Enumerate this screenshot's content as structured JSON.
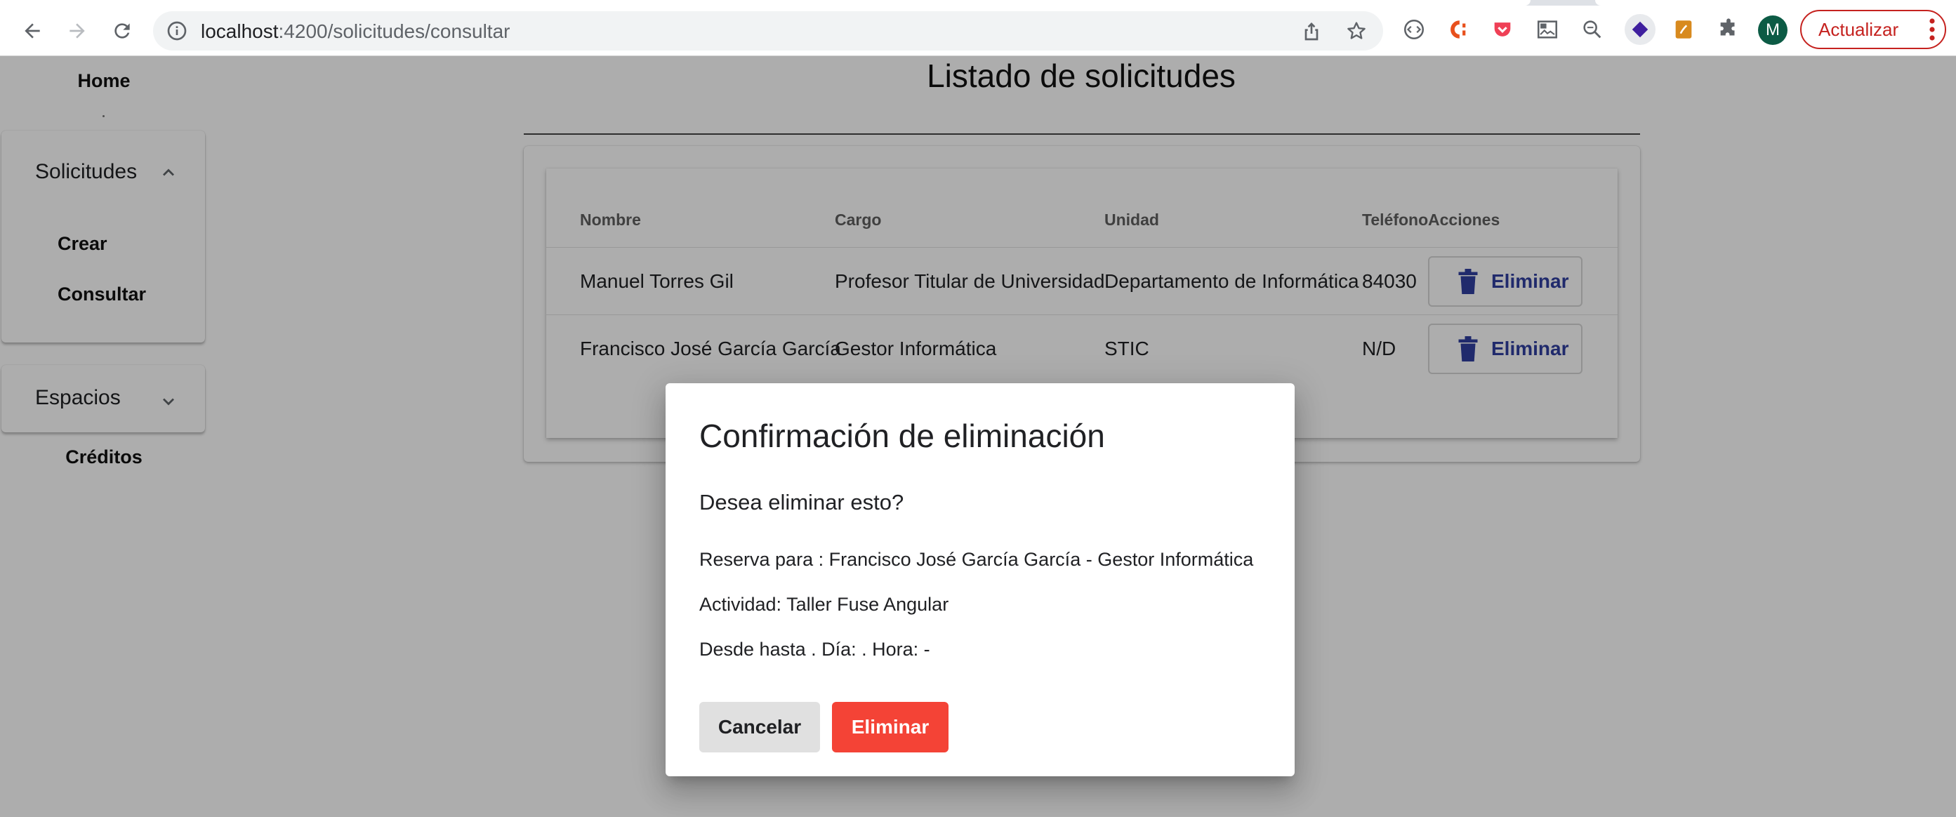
{
  "browser": {
    "url_host": "localhost",
    "url_path": ":4200/solicitudes/consultar",
    "update_label": "Actualizar",
    "avatar_initial": "M"
  },
  "sidebar": {
    "home": "Home",
    "solicitudes": {
      "label": "Solicitudes",
      "items": [
        {
          "label": "Crear"
        },
        {
          "label": "Consultar"
        }
      ]
    },
    "espacios": {
      "label": "Espacios"
    },
    "creditos": "Créditos"
  },
  "main": {
    "title": "Listado de solicitudes",
    "table": {
      "headers": [
        "Nombre",
        "Cargo",
        "Unidad",
        "Teléfono",
        "Acciones"
      ],
      "rows": [
        {
          "nombre": "Manuel Torres Gil",
          "cargo": "Profesor Titular de Universidad",
          "unidad": "Departamento de Informática",
          "telefono": "84030",
          "accion": "Eliminar"
        },
        {
          "nombre": "Francisco José García García",
          "cargo": "Gestor Informática",
          "unidad": "STIC",
          "telefono": "N/D",
          "accion": "Eliminar"
        }
      ]
    }
  },
  "dialog": {
    "title": "Confirmación de eliminación",
    "question": "Desea eliminar esto?",
    "lines": [
      "Reserva para : Francisco José García García - Gestor Informática",
      "Actividad: Taller Fuse Angular",
      "Desde hasta . Día: . Hora: -"
    ],
    "cancel": "Cancelar",
    "confirm": "Eliminar"
  },
  "colors": {
    "accent": "#303f9f",
    "danger": "#f44336",
    "update": "#c5221f"
  }
}
